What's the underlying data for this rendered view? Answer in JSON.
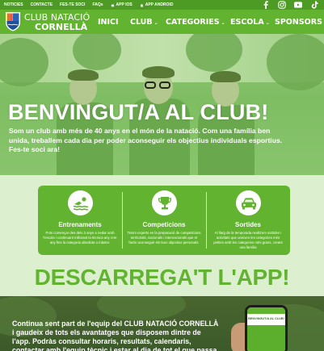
{
  "topbar": {
    "links": [
      {
        "label": "NOTICIES",
        "icon": ""
      },
      {
        "label": "CONTACTE",
        "icon": ""
      },
      {
        "label": "FES-TE SOCI",
        "icon": ""
      },
      {
        "label": "FAQs",
        "icon": ""
      },
      {
        "label": "APP IOS",
        "icon": "apple-icon"
      },
      {
        "label": "APP ANDROID",
        "icon": "android-icon"
      }
    ],
    "social_icons": [
      "facebook-icon",
      "instagram-icon",
      "youtube-icon",
      "tiktok-icon"
    ]
  },
  "nav": {
    "brand_line1": "CLUB NATACIÓ",
    "brand_line2": "CORNELLÀ",
    "items": [
      {
        "label": "INICI"
      },
      {
        "label": "CLUB"
      },
      {
        "label": "CATEGORIES"
      },
      {
        "label": "ESCOLA"
      },
      {
        "label": "SPONSORS"
      }
    ],
    "dropdown_caret": "⌄"
  },
  "hero": {
    "title": "BENVINGUT/A AL CLUB!",
    "text": "Som un club amb més de 40 anys en el món de la natació. Com una família ben unida, treballem cada dia per poder aconseguir els objectius individuals esportius. Fes-te soci ara!"
  },
  "features": [
    {
      "title": "Entrenaments",
      "icon": "swimmer-icon",
      "text": "Pots començar des dels 3 anys a nedar amb l'escola i continuant millorant la tècnica any rere any fins la categoria absoluta o màster."
    },
    {
      "title": "Competicions",
      "icon": "trophy-icon",
      "text": "Tenim experts en la preparació de competicions territorials, nacionals i internacionals que et farán aconseguir els teus objectius personals."
    },
    {
      "title": "Sortides",
      "icon": "car-icon",
      "text": "Al llarg de la temporada realitzem sortides i activitats que uneixen les categories més petites amb les categories més grans, creant una família"
    }
  ],
  "download": {
    "heading": "DESCARREGA'T L'APP!",
    "text": "Continua sent part de l'equip del CLUB NATACIÓ CORNELLÀ i gaudeix de tots els avantatges que disposem dintre de l'app. Podràs consultar horaris, resultats, calendaris, contactar amb l'equip tècnic i estar al dia de tot el que passa al voltant del club!",
    "phone_screen_text": "BENVINGUT/A AL CLUB!"
  },
  "colors": {
    "primary": "#62b330",
    "dark": "#4d9a25",
    "background": "#dcefcf"
  }
}
